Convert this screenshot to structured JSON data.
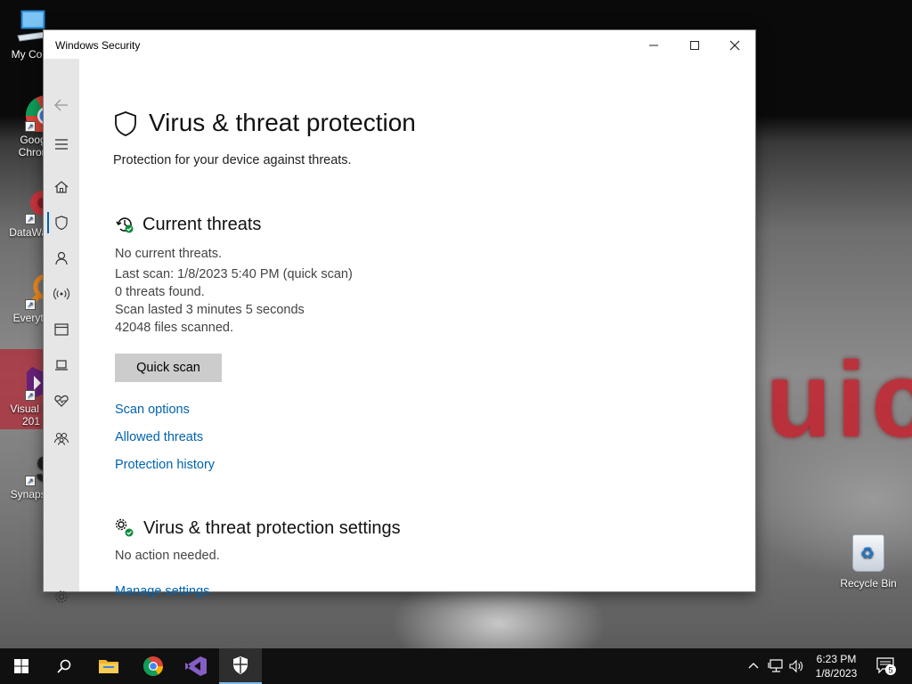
{
  "window": {
    "title": "Windows Security"
  },
  "page": {
    "title": "Virus & threat protection",
    "subtitle": "Protection for your device against threats."
  },
  "current_threats": {
    "heading": "Current threats",
    "status": "No current threats.",
    "last_scan": "Last scan: 1/8/2023 5:40 PM (quick scan)",
    "threats_found": "0 threats found.",
    "duration": "Scan lasted 3 minutes 5 seconds",
    "files_scanned": "42048 files scanned.",
    "quick_scan_label": "Quick scan",
    "links": [
      "Scan options",
      "Allowed threats",
      "Protection history"
    ]
  },
  "settings": {
    "heading": "Virus & threat protection settings",
    "status": "No action needed.",
    "manage_label": "Manage settings"
  },
  "sidebar": {
    "items": [
      "back-icon",
      "menu-icon",
      "home-icon",
      "shield-icon",
      "account-icon",
      "firewall-icon",
      "app-browser-icon",
      "device-security-icon",
      "device-health-icon",
      "family-icon",
      "settings-icon"
    ],
    "active": "shield-icon",
    "accent": "#0063b1"
  },
  "desktop": {
    "icons": [
      {
        "label": "My Com",
        "icon": "computer-icon"
      },
      {
        "label": "Goog\nChron",
        "icon": "chrome-icon"
      },
      {
        "label": "DataWag",
        "icon": "datawag-icon"
      },
      {
        "label": "Everyth",
        "icon": "everything-icon"
      },
      {
        "label": "Visual St\n201",
        "icon": "visual-studio-icon"
      },
      {
        "label": "Synapse",
        "icon": "synapse-icon"
      }
    ],
    "recycle_bin": "Recycle Bin",
    "wallpaper_text": "uic"
  },
  "taskbar": {
    "time": "6:23 PM",
    "date": "1/8/2023",
    "notification_count": "5",
    "apps": [
      "start-icon",
      "search-icon",
      "file-explorer-icon",
      "chrome-icon",
      "visual-studio-icon",
      "windows-security-icon"
    ],
    "active_app": "windows-security-icon"
  }
}
